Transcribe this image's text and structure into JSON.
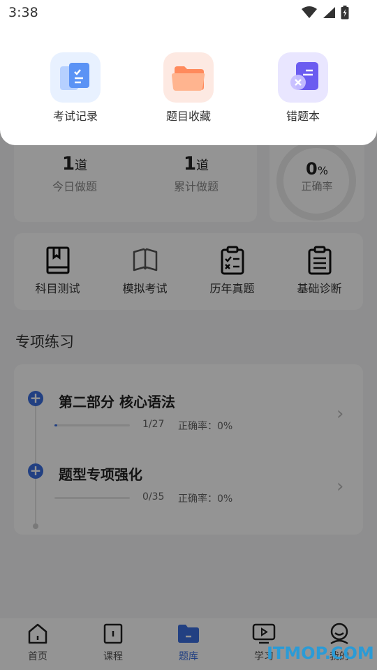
{
  "status_bar": {
    "time": "3:38"
  },
  "quick_actions": [
    {
      "label": "考试记录",
      "icon": "exam-record-icon"
    },
    {
      "label": "题目收藏",
      "icon": "folder-icon"
    },
    {
      "label": "错题本",
      "icon": "wrong-book-icon"
    }
  ],
  "stats": {
    "today": {
      "value": "1",
      "unit": "道",
      "label": "今日做题"
    },
    "total": {
      "value": "1",
      "unit": "道",
      "label": "累计做题"
    },
    "accuracy": {
      "value": "0",
      "unit": "%",
      "label": "正确率"
    }
  },
  "functions": [
    {
      "label": "科目测试",
      "icon": "book-icon"
    },
    {
      "label": "模拟考试",
      "icon": "open-book-icon"
    },
    {
      "label": "历年真题",
      "icon": "clipboard-check-icon"
    },
    {
      "label": "基础诊断",
      "icon": "clipboard-list-icon"
    }
  ],
  "section_title": "专项练习",
  "practice_items": [
    {
      "title": "第二部分 核心语法",
      "count": "1/27",
      "accuracy": "正确率：0%",
      "progress": 0.037
    },
    {
      "title": "题型专项强化",
      "count": "0/35",
      "accuracy": "正确率：0%",
      "progress": 0
    }
  ],
  "bottom_nav": [
    {
      "label": "首页",
      "icon": "home-icon"
    },
    {
      "label": "课程",
      "icon": "course-icon"
    },
    {
      "label": "题库",
      "icon": "question-bank-icon",
      "active": true
    },
    {
      "label": "学习",
      "icon": "play-screen-icon"
    },
    {
      "label": "我的",
      "icon": "profile-icon"
    }
  ],
  "watermark": "ITMOP.COM",
  "colors": {
    "accent": "#3b6fe0",
    "scrim": "rgba(0,0,0,0.42)"
  }
}
